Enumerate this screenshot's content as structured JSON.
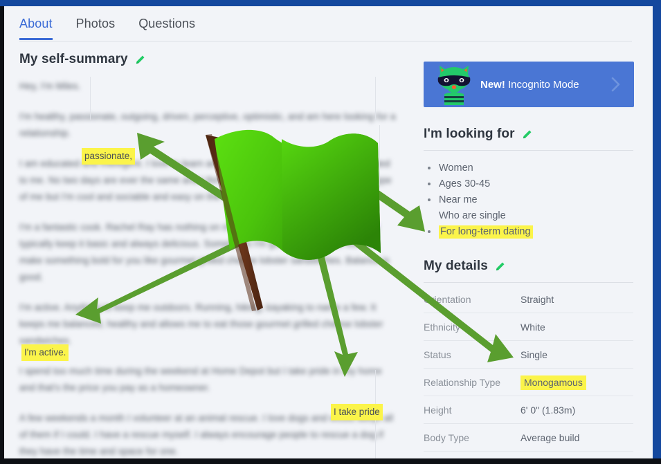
{
  "window": {
    "frame_color": "#14489e",
    "frame_dark": "#0d0f14"
  },
  "tabs": [
    {
      "label": "About",
      "active": true
    },
    {
      "label": "Photos",
      "active": false
    },
    {
      "label": "Questions",
      "active": false
    }
  ],
  "self_summary": {
    "title": "My self-summary",
    "edit_icon": "pencil-icon",
    "paragraphs": [
      "Hey, I'm Miles.",
      "I'm healthy, passionate, outgoing, driven, perceptive, optimistic, and am here looking for a relationship.",
      "I am educated and intelligent. I love to learn and take on the many challenges presented to me. No two days are ever the same and I thrive on my toes. People have a stereotype of me but I'm cool and sociable and easy on the eyes.",
      "I'm a fantastic cook. Rachel Ray has nothing on me. I am never bored in the kitchen. I typically keep it basic and always delicious. Sometimes I'm good just to go all out and make something bold for you like gourmet grilled cheese lobster sandwiches. Balance is good.",
      "I'm active. Anything to keep me outdoors. Running, hiking, kayaking to name a few. It keeps me balanced, healthy and allows me to eat those gourmet grilled cheese lobster sandwiches.",
      "I spend too much time during the weekend at Home Depot but I take pride in my home and that's the price you pay as a homeowner.",
      "A few weekends a month I volunteer at an animal rescue. I love dogs and would adopt all of them if I could. I have a rescue myself. I always encourage people to rescue a dog if they have the time and space for one."
    ],
    "highlights": [
      {
        "id": "hl-passionate",
        "text": "passionate,"
      },
      {
        "id": "hl-active",
        "text": "I'm active."
      },
      {
        "id": "hl-pride",
        "text": "I take pride"
      }
    ]
  },
  "incognito": {
    "badge": "New!",
    "label": "Incognito Mode",
    "mascot_icon": "raccoon-mascot-icon",
    "chevron_icon": "chevron-right-icon",
    "bg_color": "#4a76d4"
  },
  "looking_for": {
    "title": "I'm looking for",
    "edit_icon": "pencil-icon",
    "items": [
      {
        "text": "Women",
        "bulleted": true,
        "highlighted": false
      },
      {
        "text": "Ages 30-45",
        "bulleted": true,
        "highlighted": false
      },
      {
        "text": "Near me",
        "bulleted": true,
        "highlighted": false
      },
      {
        "text": "Who are single",
        "bulleted": false,
        "highlighted": false
      },
      {
        "text": "For long-term dating",
        "bulleted": true,
        "highlighted": true
      }
    ]
  },
  "my_details": {
    "title": "My details",
    "edit_icon": "pencil-icon",
    "rows": [
      {
        "label": "Orientation",
        "value": "Straight",
        "highlighted": false
      },
      {
        "label": "Ethnicity",
        "value": "White",
        "highlighted": false
      },
      {
        "label": "Status",
        "value": "Single",
        "highlighted": false
      },
      {
        "label": "Relationship Type",
        "value": "Monogamous",
        "highlighted": true
      },
      {
        "label": "Height",
        "value": "6' 0\" (1.83m)",
        "highlighted": false
      },
      {
        "label": "Body Type",
        "value": "Average build",
        "highlighted": false
      }
    ]
  },
  "annotation": {
    "flag_icon": "green-flag-icon",
    "flag_color_light": "#5ce011",
    "flag_color_dark": "#2f8a08",
    "pole_color": "#5a2d16",
    "arrow_color": "#5a9e2f",
    "arrows": [
      {
        "name": "arrow-to-passionate",
        "target": "passionate,"
      },
      {
        "name": "arrow-to-long-term-dating",
        "target": "For long-term dating"
      },
      {
        "name": "arrow-to-im-active",
        "target": "I'm active."
      },
      {
        "name": "arrow-to-i-take-pride",
        "target": "I take pride"
      },
      {
        "name": "arrow-to-monogamous",
        "target": "Monogamous"
      }
    ]
  },
  "colors": {
    "accent_blue": "#3b6bd6",
    "highlight_yellow": "#fbf44a",
    "page_bg": "#f2f4f8",
    "edit_green": "#22cc66"
  }
}
